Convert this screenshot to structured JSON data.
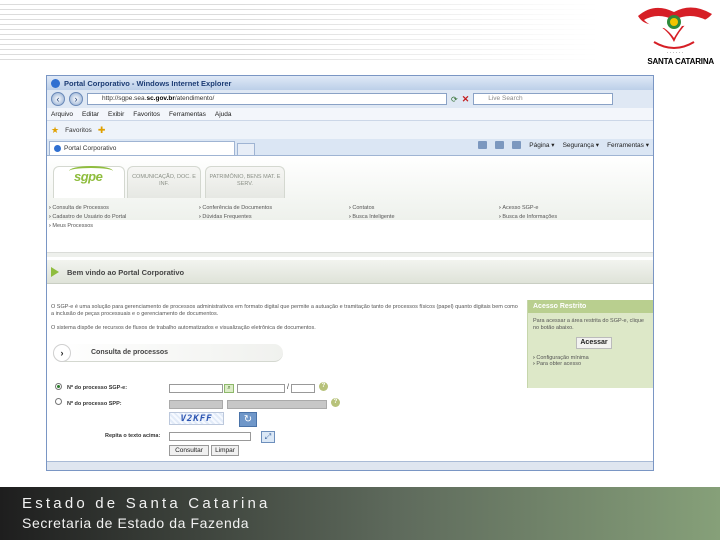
{
  "brand": {
    "state_label": "SANTA CATARINA",
    "colors": {
      "red": "#d61f26",
      "green": "#2f8a3b",
      "yellow": "#f4c400"
    }
  },
  "browser": {
    "title": "Portal Corporativo - Windows Internet Explorer",
    "url_prefix": "http://sgpe.sea.",
    "url_domain": "sc.gov.br",
    "url_suffix": "/atendimento/",
    "search_placeholder": "Live Search",
    "menu": [
      "Arquivo",
      "Editar",
      "Exibir",
      "Favoritos",
      "Ferramentas",
      "Ajuda"
    ],
    "favorites_label": "Favoritos",
    "tab_title": "Portal Corporativo",
    "commands": [
      "Página ▾",
      "Segurança ▾",
      "Ferramentas ▾"
    ]
  },
  "portal": {
    "logo_text": "sgpe",
    "tabs": [
      {
        "label": "COMUNICAÇÃO, DOC. E INF."
      },
      {
        "label": "PATRIMÔNIO, BENS MAT. E SERV."
      }
    ],
    "links_col1": [
      "Consulta de Processos",
      "Cadastro de Usuário do Portal",
      "Meus Processos"
    ],
    "links_col2": [
      "Conferência de Documentos",
      "Dúvidas Frequentes"
    ],
    "links_col3": [
      "Contatos",
      "Busca Inteligente"
    ],
    "links_col4": [
      "Acesso SGP-e",
      "Busca de Informações"
    ],
    "welcome_title": "Bem vindo ao Portal Corporativo",
    "intro_p1": "O SGP-e é uma solução para gerenciamento de processos administrativos em formato digital que permite a autuação e tramitação tanto de processos físicos (papel) quanto digitais bem como a inclusão de peças processuais e o gerenciamento de documentos.",
    "intro_p2": "O sistema dispõe de recursos de fluxos de trabalho automatizados e visualização eletrônica de documentos.",
    "consulta_title": "Consulta de processos",
    "form": {
      "label_sgpe": "Nº do processo SGP-e:",
      "label_spp": "Nº do processo SPP:",
      "label_captcha": "Repita o texto acima:",
      "captcha_text": "V2KFF",
      "btn_consultar": "Consultar",
      "btn_limpar": "Limpar",
      "selected": "sgpe"
    },
    "aside": {
      "title": "Acesso Restrito",
      "text": "Para acessar a área restrita do SGP-e, clique no botão abaixo.",
      "button": "Acessar",
      "links": [
        "Configuração mínima",
        "Para obter acesso"
      ]
    }
  },
  "footer": {
    "line1": "Estado de Santa Catarina",
    "line2": "Secretaria de Estado da Fazenda"
  }
}
